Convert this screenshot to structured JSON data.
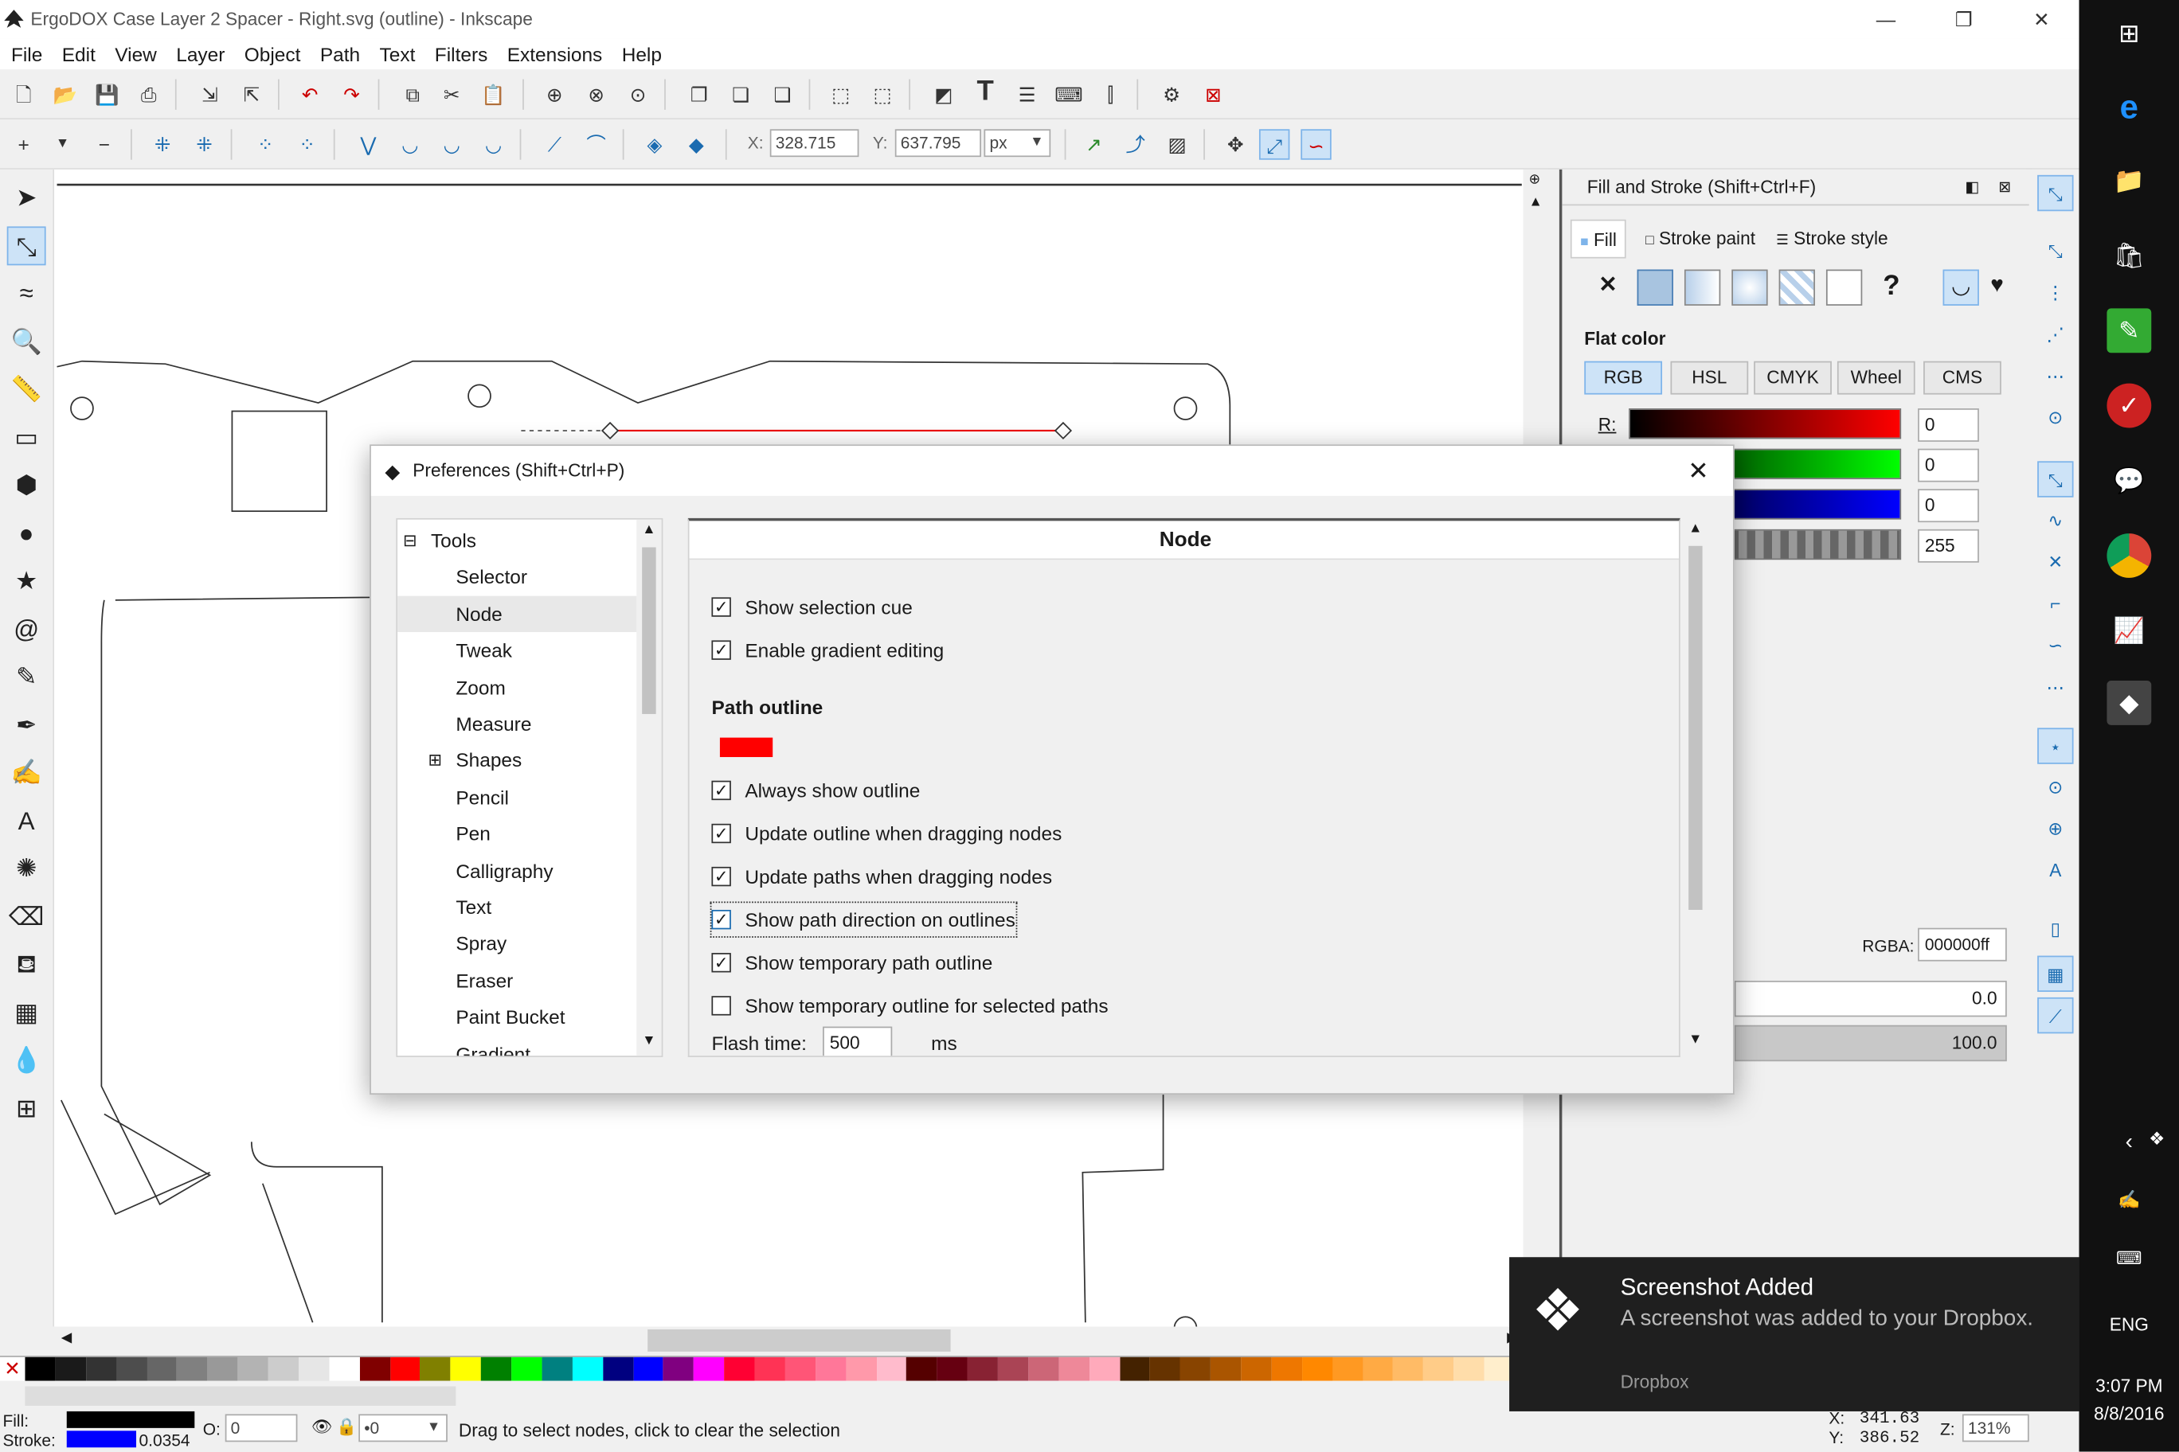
{
  "window": {
    "title": "ErgoDOX Case Layer 2 Spacer - Right.svg (outline) - Inkscape",
    "minimize": "—",
    "maximize": "❐",
    "close": "✕"
  },
  "menu": [
    "File",
    "Edit",
    "View",
    "Layer",
    "Object",
    "Path",
    "Text",
    "Filters",
    "Extensions",
    "Help"
  ],
  "node_toolbar": {
    "x_label": "X:",
    "x_value": "328.715",
    "y_label": "Y:",
    "y_value": "637.795",
    "unit": "px"
  },
  "tools": [
    {
      "name": "selector-tool-icon",
      "glyph": "➤"
    },
    {
      "name": "node-tool-icon",
      "glyph": "⤡",
      "active": true
    },
    {
      "name": "tweak-tool-icon",
      "glyph": "≈"
    },
    {
      "name": "zoom-tool-icon",
      "glyph": "🔍"
    },
    {
      "name": "measure-tool-icon",
      "glyph": "📏"
    },
    {
      "name": "rect-tool-icon",
      "glyph": "▭"
    },
    {
      "name": "3dbox-tool-icon",
      "glyph": "⬢"
    },
    {
      "name": "ellipse-tool-icon",
      "glyph": "●"
    },
    {
      "name": "star-tool-icon",
      "glyph": "★"
    },
    {
      "name": "spiral-tool-icon",
      "glyph": "@"
    },
    {
      "name": "pencil-tool-icon",
      "glyph": "✎"
    },
    {
      "name": "pen-tool-icon",
      "glyph": "✒"
    },
    {
      "name": "calligraphy-tool-icon",
      "glyph": "✍"
    },
    {
      "name": "text-tool-icon",
      "glyph": "A"
    },
    {
      "name": "spray-tool-icon",
      "glyph": "✺"
    },
    {
      "name": "eraser-tool-icon",
      "glyph": "⌫"
    },
    {
      "name": "paint-bucket-tool-icon",
      "glyph": "⛾"
    },
    {
      "name": "gradient-tool-icon",
      "glyph": "▦"
    },
    {
      "name": "dropper-tool-icon",
      "glyph": "💧"
    },
    {
      "name": "connector-tool-icon",
      "glyph": "⊞"
    }
  ],
  "fill_stroke": {
    "title": "Fill and Stroke (Shift+Ctrl+F)",
    "tabs": [
      "Fill",
      "Stroke paint",
      "Stroke style"
    ],
    "flat_color_label": "Flat color",
    "modes": [
      "RGB",
      "HSL",
      "CMYK",
      "Wheel",
      "CMS"
    ],
    "r_label": "R:",
    "channels": [
      "0",
      "0",
      "0",
      "255"
    ],
    "rgba_label": "RGBA:",
    "rgba_value": "000000ff",
    "blur_value": "0.0",
    "opacity_value": "100.0"
  },
  "preferences": {
    "title": "Preferences (Shift+Ctrl+P)",
    "tree": [
      {
        "label": "Tools",
        "indent": 1,
        "expander": "⊟"
      },
      {
        "label": "Selector",
        "indent": 2
      },
      {
        "label": "Node",
        "indent": 2,
        "selected": true
      },
      {
        "label": "Tweak",
        "indent": 2
      },
      {
        "label": "Zoom",
        "indent": 2
      },
      {
        "label": "Measure",
        "indent": 2
      },
      {
        "label": "Shapes",
        "indent": 2,
        "expander": "⊞"
      },
      {
        "label": "Pencil",
        "indent": 2
      },
      {
        "label": "Pen",
        "indent": 2
      },
      {
        "label": "Calligraphy",
        "indent": 2
      },
      {
        "label": "Text",
        "indent": 2
      },
      {
        "label": "Spray",
        "indent": 2
      },
      {
        "label": "Eraser",
        "indent": 2
      },
      {
        "label": "Paint Bucket",
        "indent": 2
      },
      {
        "label": "Gradient",
        "indent": 2
      }
    ],
    "panel_title": "Node",
    "checks_top": [
      {
        "label": "Show selection cue",
        "checked": true
      },
      {
        "label": "Enable gradient editing",
        "checked": true
      }
    ],
    "path_outline_label": "Path outline",
    "outline_color": "#ff0000",
    "checks_bottom": [
      {
        "label": "Always show outline",
        "checked": true
      },
      {
        "label": "Update outline when dragging nodes",
        "checked": true
      },
      {
        "label": "Update paths when dragging nodes",
        "checked": true
      },
      {
        "label": "Show path direction on outlines",
        "checked": true,
        "focused": true
      },
      {
        "label": "Show temporary path outline",
        "checked": true
      },
      {
        "label": "Show temporary outline for selected paths",
        "checked": false
      }
    ],
    "flash_time_label": "Flash time:",
    "flash_time_value": "500",
    "flash_time_unit": "ms"
  },
  "status": {
    "fill_label": "Fill:",
    "stroke_label": "Stroke:",
    "stroke_width": "0.0354",
    "opacity_label": "O:",
    "opacity_value": "0",
    "layer_value": "•0",
    "message": "Drag to select nodes, click to clear the selection",
    "cursor_x_label": "X:",
    "cursor_x": "341.63",
    "cursor_y_label": "Y:",
    "cursor_y": "386.52",
    "zoom_label": "Z:",
    "zoom_value": "131%"
  },
  "toast": {
    "title": "Screenshot Added",
    "body": "A screenshot was added to your Dropbox.",
    "source": "Dropbox"
  },
  "taskbar": {
    "language": "ENG",
    "time": "3:07 PM",
    "date": "8/8/2016"
  },
  "palette": [
    "#000000",
    "#1a1a1a",
    "#333333",
    "#4d4d4d",
    "#666666",
    "#808080",
    "#999999",
    "#b3b3b3",
    "#cccccc",
    "#e6e6e6",
    "#ffffff",
    "#800000",
    "#ff0000",
    "#808000",
    "#ffff00",
    "#008000",
    "#00ff00",
    "#008080",
    "#00ffff",
    "#000080",
    "#0000ff",
    "#800080",
    "#ff00ff",
    "#ff0033",
    "#ff3355",
    "#ff5577",
    "#ff7799",
    "#ff99aa",
    "#ffbbcc",
    "#550000",
    "#660011",
    "#882233",
    "#aa4455",
    "#cc6677",
    "#ee8899",
    "#ffaabb",
    "#442200",
    "#663300",
    "#884400",
    "#aa5500",
    "#cc6600",
    "#ee7700",
    "#ff8800",
    "#ff9922",
    "#ffaa44",
    "#ffbb66",
    "#ffcc88",
    "#ffddaa",
    "#ffeecc"
  ]
}
